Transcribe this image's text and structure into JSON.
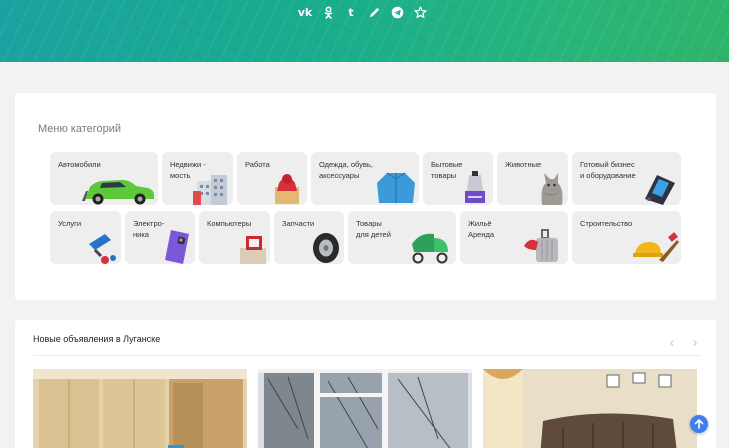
{
  "share": {
    "icons": [
      "vk-icon",
      "odnoklassniki-icon",
      "tumblr-icon",
      "pencil-icon",
      "telegram-icon",
      "star-icon"
    ],
    "vk_text": "vk",
    "tumblr_text": "t"
  },
  "categories": {
    "heading": "Меню категорий",
    "items": [
      {
        "label": "Автомобили",
        "icon": "car-icon"
      },
      {
        "label": "Недвижи -\nмость",
        "icon": "building-icon"
      },
      {
        "label": "Работа",
        "icon": "briefcase-icon"
      },
      {
        "label": "Одежда, обувь,\nаксессуары",
        "icon": "jacket-icon"
      },
      {
        "label": "Бытовые\nтовары",
        "icon": "household-icon"
      },
      {
        "label": "Животные",
        "icon": "cat-icon"
      },
      {
        "label": "Готовый бизнес\nи оборудование",
        "icon": "terminal-icon"
      },
      {
        "label": "Услуги",
        "icon": "paint-roller-icon"
      },
      {
        "label": "Электро-\nника",
        "icon": "smartphone-icon"
      },
      {
        "label": "Компьютеры",
        "icon": "computer-icon"
      },
      {
        "label": "Запчасти",
        "icon": "tire-icon"
      },
      {
        "label": "Товары\nдля детей",
        "icon": "stroller-icon"
      },
      {
        "label": "Жильё\nАренда",
        "icon": "suitcase-icon"
      },
      {
        "label": "Строительство",
        "icon": "hard-hat-icon"
      }
    ]
  },
  "listings": {
    "title": "Новые объявления в Луганске",
    "prev_arrow": "‹",
    "next_arrow": "›"
  },
  "colors": {
    "banner_start": "#1aa2a0",
    "banner_end": "#2fb46a",
    "scroll_button": "#3d7ef0"
  }
}
